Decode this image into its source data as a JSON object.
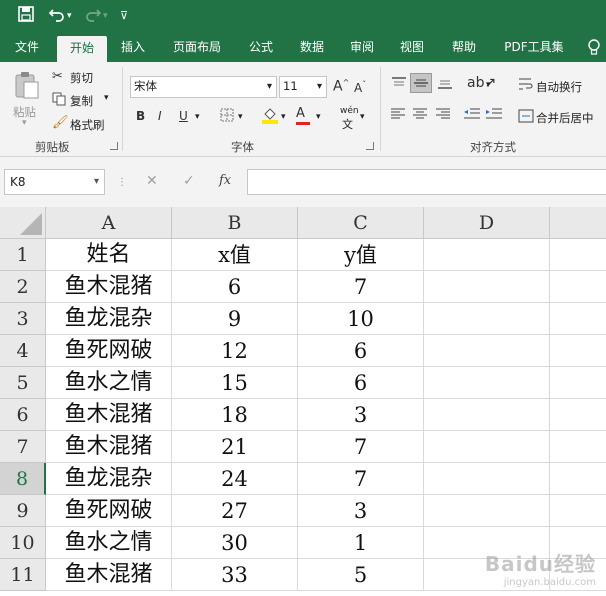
{
  "toolbar": {
    "save_icon": "save-icon",
    "undo_icon": "undo-icon",
    "redo_icon": "redo-icon",
    "customize_icon": "customize-quick-access-icon"
  },
  "tabs": [
    {
      "label": "文件"
    },
    {
      "label": "开始"
    },
    {
      "label": "插入"
    },
    {
      "label": "页面布局"
    },
    {
      "label": "公式"
    },
    {
      "label": "数据"
    },
    {
      "label": "审阅"
    },
    {
      "label": "视图"
    },
    {
      "label": "帮助"
    },
    {
      "label": "PDF工具集"
    }
  ],
  "active_tab": "开始",
  "ribbon": {
    "clipboard": {
      "paste": "粘贴",
      "cut": "剪切",
      "copy": "复制",
      "format_painter": "格式刷",
      "group_label": "剪贴板"
    },
    "font": {
      "font_name": "宋体",
      "font_size": "11",
      "grow": "A",
      "shrink": "A",
      "bold": "B",
      "italic": "I",
      "underline": "U",
      "font_color": "A",
      "phonetic": "wén",
      "group_label": "字体"
    },
    "alignment": {
      "wrap_text": "自动换行",
      "merge_center": "合并后居中",
      "group_label": "对齐方式"
    }
  },
  "formula_bar": {
    "name_box": "K8",
    "cancel": "✕",
    "enter": "✓",
    "fx": "fx",
    "value": ""
  },
  "sheet": {
    "columns": [
      "A",
      "B",
      "C",
      "D"
    ],
    "row_numbers": [
      "1",
      "2",
      "3",
      "4",
      "5",
      "6",
      "7",
      "8",
      "9",
      "10",
      "11"
    ],
    "selected_row": "8",
    "rows": [
      [
        "姓名",
        "x值",
        "y值",
        ""
      ],
      [
        "鱼木混猪",
        "6",
        "7",
        ""
      ],
      [
        "鱼龙混杂",
        "9",
        "10",
        ""
      ],
      [
        "鱼死网破",
        "12",
        "6",
        ""
      ],
      [
        "鱼水之情",
        "15",
        "6",
        ""
      ],
      [
        "鱼木混猪",
        "18",
        "3",
        ""
      ],
      [
        "鱼木混猪",
        "21",
        "7",
        ""
      ],
      [
        "鱼龙混杂",
        "24",
        "7",
        ""
      ],
      [
        "鱼死网破",
        "27",
        "3",
        ""
      ],
      [
        "鱼水之情",
        "30",
        "1",
        ""
      ],
      [
        "鱼木混猪",
        "33",
        "5",
        ""
      ]
    ]
  },
  "watermark": {
    "brand": "Baidu经验",
    "url": "jingyan.baidu.com"
  },
  "colors": {
    "excel_green": "#217346",
    "ribbon_bg": "#f3f3f3",
    "header_bg": "#e9e9e9",
    "gridline": "#dadada"
  }
}
